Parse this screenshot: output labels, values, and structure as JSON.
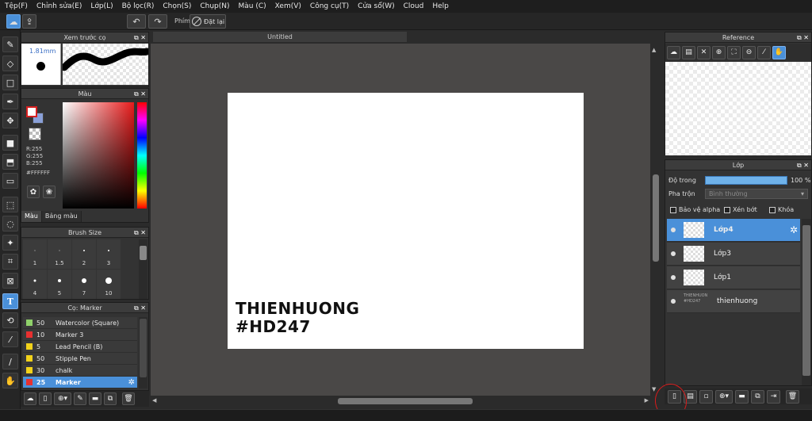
{
  "menu": [
    "Tệp(F)",
    "Chỉnh sửa(E)",
    "Lớp(L)",
    "Bộ lọc(R)",
    "Chọn(S)",
    "Chụp(N)",
    "Màu (C)",
    "Xem(V)",
    "Công cụ(T)",
    "Cửa sổ(W)",
    "Cloud",
    "Help"
  ],
  "toolbar": {
    "pen_label": "Phím",
    "reset_label": "Đặt lại"
  },
  "brush_preview": {
    "title": "Xem trước cọ",
    "size": "1.81mm"
  },
  "color_panel": {
    "title": "Màu",
    "r": "R:255",
    "g": "G:255",
    "b": "B:255",
    "hex": "#FFFFFF",
    "tabs": [
      "Màu",
      "Bảng màu"
    ]
  },
  "brush_size": {
    "title": "Brush Size",
    "sizes": [
      "1",
      "1.5",
      "2",
      "3",
      "4",
      "5",
      "7",
      "10"
    ]
  },
  "brush_list": {
    "title": "Cọ: Marker",
    "items": [
      {
        "size": "50",
        "name": "Watercolor (Square)",
        "color": "#8fd16a"
      },
      {
        "size": "10",
        "name": "Marker 3",
        "color": "#e83030"
      },
      {
        "size": "5",
        "name": "Lead Pencil (B)",
        "color": "#f2d21a"
      },
      {
        "size": "50",
        "name": "Stipple Pen",
        "color": "#f2d21a"
      },
      {
        "size": "30",
        "name": "chalk",
        "color": "#f2d21a"
      },
      {
        "size": "25",
        "name": "Marker",
        "color": "#e83030",
        "selected": true
      }
    ]
  },
  "document": {
    "tab": "Untitled",
    "text_line1": "THIENHUONG",
    "text_line2": "#HD247"
  },
  "reference": {
    "title": "Reference"
  },
  "layers": {
    "title": "Lớp",
    "opacity_label": "Độ trong",
    "opacity_value": "100 %",
    "opacity_fraction": 1.0,
    "blend_label": "Pha trộn",
    "blend_value": "Bình thường",
    "protect_alpha": "Bảo vệ alpha",
    "clipping": "Xén bớt",
    "lock": "Khóa",
    "items": [
      {
        "name": "Lớp4",
        "selected": true
      },
      {
        "name": "Lớp3"
      },
      {
        "name": "Lớp1"
      },
      {
        "name": "thienhuong",
        "text_thumb": "THIENHUONG #HD247"
      }
    ]
  },
  "colors": {
    "accent": "#4a90d9",
    "panel": "#333333",
    "annotation": "#d81b1b"
  }
}
